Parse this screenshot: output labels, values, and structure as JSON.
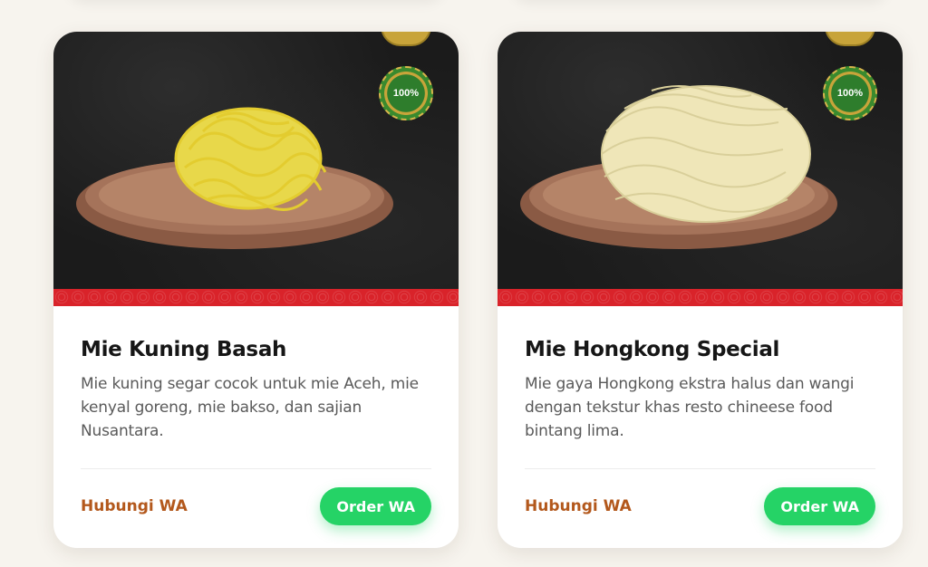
{
  "products": [
    {
      "title": "Mie Kuning Basah",
      "description": "Mie kuning segar cocok untuk mie Aceh, mie kenyal goreng, mie bakso, dan sajian Nusantara.",
      "link_label": "Hubungi WA",
      "button_label": "Order WA",
      "badge_text": "100%",
      "noodle_color": "#e8d84a",
      "image_icon": "yellow-noodle-plate-icon"
    },
    {
      "title": "Mie Hongkong Special",
      "description": "Mie gaya Hongkong ekstra halus dan wangi dengan tekstur khas resto chineese food bintang lima.",
      "link_label": "Hubungi WA",
      "button_label": "Order WA",
      "badge_text": "100%",
      "noodle_color": "#efe6b8",
      "image_icon": "hongkong-noodle-plate-icon"
    }
  ],
  "colors": {
    "accent_link": "#b3581c",
    "whatsapp_green": "#25d366",
    "band_red": "#d9232a",
    "page_background": "#f7f4ee"
  }
}
